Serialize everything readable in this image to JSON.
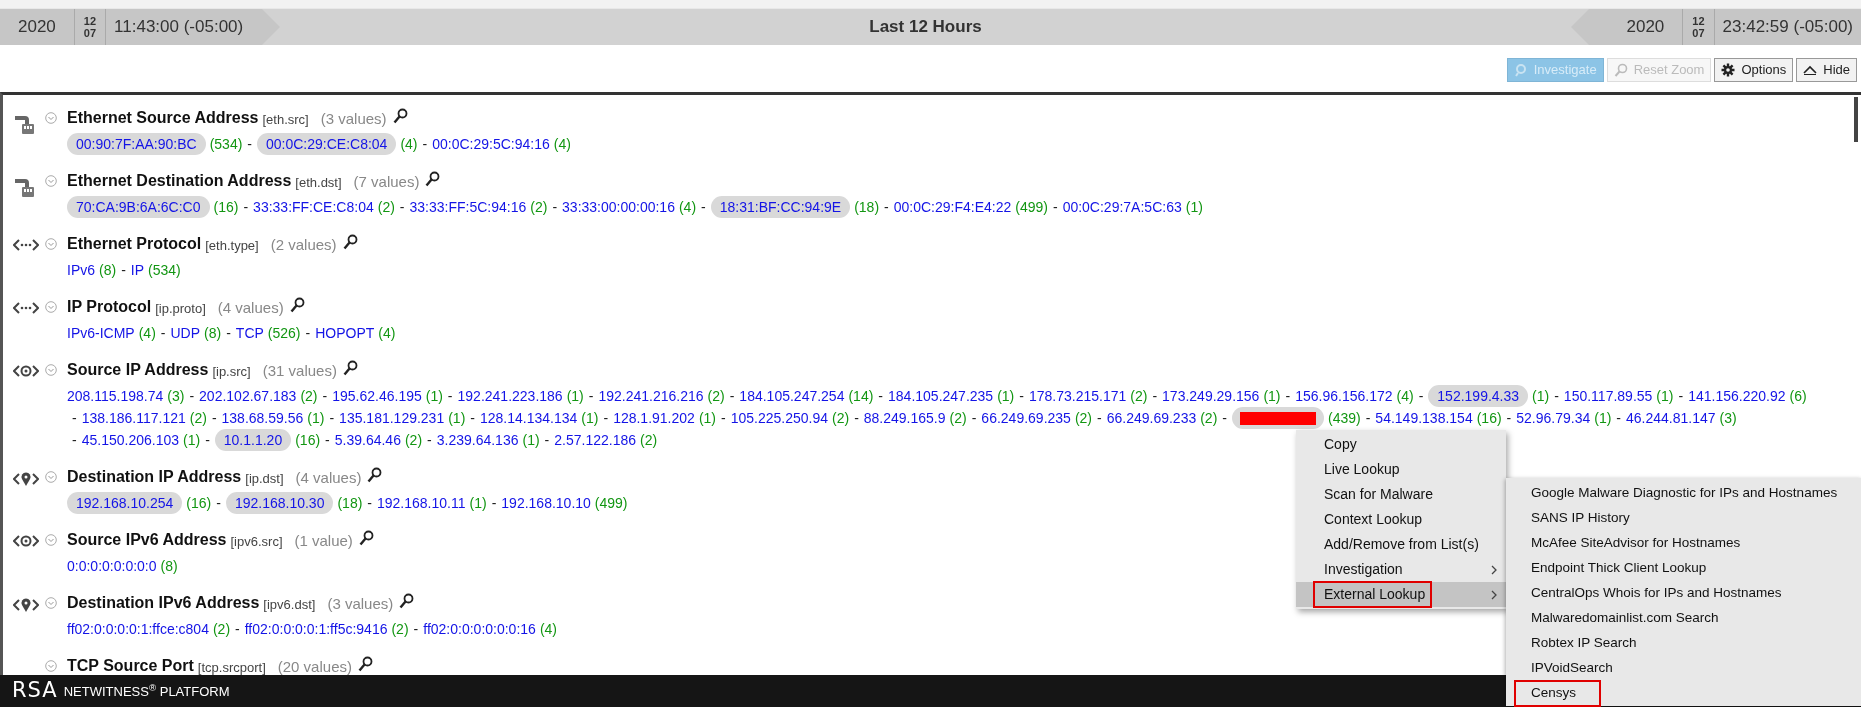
{
  "time_range": {
    "start": {
      "year": "2020",
      "month": "12",
      "day": "07",
      "time": "11:43:00 (-05:00)"
    },
    "label": "Last 12 Hours",
    "end": {
      "year": "2020",
      "month": "12",
      "day": "07",
      "time": "23:42:59 (-05:00)"
    }
  },
  "toolbar": [
    {
      "label": "Investigate",
      "kind": "investigate",
      "disabled": true
    },
    {
      "label": "Reset Zoom",
      "kind": "zoom",
      "disabled": true
    },
    {
      "label": "Options",
      "kind": "gear",
      "disabled": false
    },
    {
      "label": "Hide",
      "kind": "caret_up",
      "disabled": false
    }
  ],
  "meta_groups": [
    {
      "kind": "ethernet",
      "title": "Ethernet Source Address",
      "key": "[eth.src]",
      "count": "(3 values)",
      "separator": "-",
      "values": [
        {
          "value": "00:90:7F:AA:90:BC",
          "count": "(534)",
          "selected": true
        },
        {
          "value": "00:0C:29:CE:C8:04",
          "count": "(4)",
          "selected": true
        },
        {
          "value": "00:0C:29:5C:94:16",
          "count": "(4)",
          "selected": false
        }
      ]
    },
    {
      "kind": "ethernet",
      "title": "Ethernet Destination Address",
      "key": "[eth.dst]",
      "count": "(7 values)",
      "separator": "-",
      "values": [
        {
          "value": "70:CA:9B:6A:6C:C0",
          "count": "(16)",
          "selected": true
        },
        {
          "value": "33:33:FF:CE:C8:04",
          "count": "(2)",
          "selected": false
        },
        {
          "value": "33:33:FF:5C:94:16",
          "count": "(2)",
          "selected": false
        },
        {
          "value": "33:33:00:00:00:16",
          "count": "(4)",
          "selected": false
        },
        {
          "value": "18:31:BF:CC:94:9E",
          "count": "(18)",
          "selected": true
        },
        {
          "value": "00:0C:29:F4:E4:22",
          "count": "(499)",
          "selected": false
        },
        {
          "value": "00:0C:29:7A:5C:63",
          "count": "(1)",
          "selected": false
        }
      ]
    },
    {
      "kind": "protocol",
      "title": "Ethernet Protocol",
      "key": "[eth.type]",
      "count": "(2 values)",
      "separator": "-",
      "values": [
        {
          "value": "IPv6",
          "count": "(8)",
          "selected": false
        },
        {
          "value": "IP",
          "count": "(534)",
          "selected": false
        }
      ]
    },
    {
      "kind": "protocol",
      "title": "IP Protocol",
      "key": "[ip.proto]",
      "count": "(4 values)",
      "separator": "-",
      "values": [
        {
          "value": "IPv6-ICMP",
          "count": "(4)",
          "selected": false
        },
        {
          "value": "UDP",
          "count": "(8)",
          "selected": false
        },
        {
          "value": "TCP",
          "count": "(526)",
          "selected": false
        },
        {
          "value": "HOPOPT",
          "count": "(4)",
          "selected": false
        }
      ]
    },
    {
      "kind": "source",
      "title": "Source IP Address",
      "key": "[ip.src]",
      "count": "(31 values)",
      "separator": "-",
      "values": [
        {
          "value": "208.115.198.74",
          "count": "(3)",
          "selected": false
        },
        {
          "value": "202.102.67.183",
          "count": "(2)",
          "selected": false
        },
        {
          "value": "195.62.46.195",
          "count": "(1)",
          "selected": false
        },
        {
          "value": "192.241.223.186",
          "count": "(1)",
          "selected": false
        },
        {
          "value": "192.241.216.216",
          "count": "(2)",
          "selected": false
        },
        {
          "value": "184.105.247.254",
          "count": "(14)",
          "selected": false
        },
        {
          "value": "184.105.247.235",
          "count": "(1)",
          "selected": false
        },
        {
          "value": "178.73.215.171",
          "count": "(2)",
          "selected": false
        },
        {
          "value": "173.249.29.156",
          "count": "(1)",
          "selected": false
        },
        {
          "value": "156.96.156.172",
          "count": "(4)",
          "selected": false
        },
        {
          "value": "152.199.4.33",
          "count": "(1)",
          "selected": true
        },
        {
          "value": "150.117.89.55",
          "count": "(1)",
          "selected": false
        },
        {
          "value": "141.156.220.92",
          "count": "(6)",
          "selected": false
        },
        {
          "value": "138.186.117.121",
          "count": "(2)",
          "selected": false
        },
        {
          "value": "138.68.59.56",
          "count": "(1)",
          "selected": false
        },
        {
          "value": "135.181.129.231",
          "count": "(1)",
          "selected": false
        },
        {
          "value": "128.14.134.134",
          "count": "(1)",
          "selected": false
        },
        {
          "value": "128.1.91.202",
          "count": "(1)",
          "selected": false
        },
        {
          "value": "105.225.250.94",
          "count": "(2)",
          "selected": false
        },
        {
          "value": "88.249.165.9",
          "count": "(2)",
          "selected": false
        },
        {
          "value": "66.249.69.235",
          "count": "(2)",
          "selected": false
        },
        {
          "value": "66.249.69.233",
          "count": "(2)",
          "selected": false
        },
        {
          "redacted": true,
          "count": "(439)",
          "selected": true
        },
        {
          "value": "54.149.138.154",
          "count": "(16)",
          "selected": false
        },
        {
          "value": "52.96.79.34",
          "count": "(1)",
          "selected": false
        },
        {
          "value": "46.244.81.147",
          "count": "(3)",
          "selected": false
        },
        {
          "value": "45.150.206.103",
          "count": "(1)",
          "selected": false
        },
        {
          "value": "10.1.1.20",
          "count": "(16)",
          "selected": true
        },
        {
          "value": "5.39.64.46",
          "count": "(2)",
          "selected": false
        },
        {
          "value": "3.239.64.136",
          "count": "(1)",
          "selected": false
        },
        {
          "value": "2.57.122.186",
          "count": "(2)",
          "selected": false
        }
      ]
    },
    {
      "kind": "destination",
      "title": "Destination IP Address",
      "key": "[ip.dst]",
      "count": "(4 values)",
      "separator": "-",
      "values": [
        {
          "value": "192.168.10.254",
          "count": "(16)",
          "selected": true
        },
        {
          "value": "192.168.10.30",
          "count": "(18)",
          "selected": true
        },
        {
          "value": "192.168.10.11",
          "count": "(1)",
          "selected": false
        },
        {
          "value": "192.168.10.10",
          "count": "(499)",
          "selected": false
        }
      ]
    },
    {
      "kind": "source",
      "title": "Source IPv6 Address",
      "key": "[ipv6.src]",
      "count": "(1 value)",
      "values": [
        {
          "value": "0:0:0:0:0:0:0:0",
          "count": "(8)",
          "selected": false
        }
      ]
    },
    {
      "kind": "destination",
      "title": "Destination IPv6 Address",
      "key": "[ipv6.dst]",
      "count": "(3 values)",
      "separator": "-",
      "values": [
        {
          "value": "ff02:0:0:0:0:1:ffce:c804",
          "count": "(2)",
          "selected": false
        },
        {
          "value": "ff02:0:0:0:0:1:ff5c:9416",
          "count": "(2)",
          "selected": false
        },
        {
          "value": "ff02:0:0:0:0:0:0:16",
          "count": "(4)",
          "selected": false
        }
      ]
    },
    {
      "title": "TCP Source Port",
      "key": "[tcp.srcport]",
      "count": "(20 values)"
    }
  ],
  "context_menu": {
    "items": [
      {
        "label": "Copy",
        "has_submenu": false,
        "selected": false,
        "outlined": false
      },
      {
        "label": "Live Lookup",
        "has_submenu": false,
        "selected": false,
        "outlined": false
      },
      {
        "label": "Scan for Malware",
        "has_submenu": false,
        "selected": false,
        "outlined": false
      },
      {
        "label": "Context Lookup",
        "has_submenu": false,
        "selected": false,
        "outlined": false
      },
      {
        "label": "Add/Remove from List(s)",
        "has_submenu": false,
        "selected": false,
        "outlined": false
      },
      {
        "label": "Investigation",
        "has_submenu": true,
        "selected": false,
        "outlined": false
      },
      {
        "label": "External Lookup",
        "has_submenu": true,
        "selected": true,
        "outlined": true
      }
    ]
  },
  "submenu": {
    "items": [
      {
        "label": "Google Malware Diagnostic for IPs and Hostnames",
        "outlined": false
      },
      {
        "label": "SANS IP History",
        "outlined": false
      },
      {
        "label": "McAfee SiteAdvisor for Hostnames",
        "outlined": false
      },
      {
        "label": "Endpoint Thick Client Lookup",
        "outlined": false
      },
      {
        "label": "CentralOps Whois for IPs and Hostnames",
        "outlined": false
      },
      {
        "label": "Malwaredomainlist.com Search",
        "outlined": false
      },
      {
        "label": "Robtex IP Search",
        "outlined": false
      },
      {
        "label": "IPVoidSearch",
        "outlined": false
      },
      {
        "label": "Censys",
        "outlined": true
      }
    ]
  },
  "footer": {
    "logo": "RSA",
    "product": "NETWITNESS$^{®}$ PLATFORM"
  }
}
